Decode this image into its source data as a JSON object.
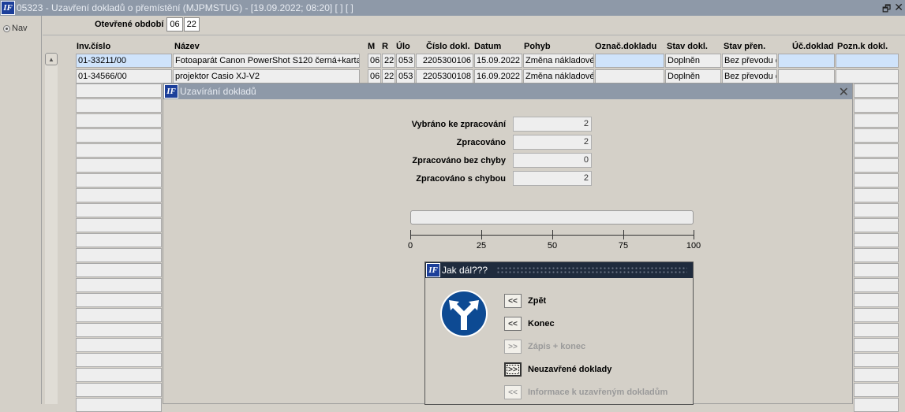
{
  "window": {
    "title": "05323 - Uzavření dokladů o přemístění (MJPMSTUG) - [19.09.2022; 08:20]  [ ]  [ ]",
    "logo": "IF",
    "restore_icon": "restore-icon",
    "close_icon": "close-icon"
  },
  "nav": {
    "label": "Nav"
  },
  "filter": {
    "label": "Otevřené období",
    "month": "06",
    "year": "22"
  },
  "table": {
    "columns": [
      "Inv.číslo",
      "Název",
      "M",
      "R",
      "Úlo",
      "Číslo dokl.",
      "Datum",
      "Pohyb",
      "Označ.dokladu",
      "Stav dokl.",
      "Stav přen.",
      "Úč.doklad",
      "Pozn.k dokl."
    ],
    "rows": [
      [
        "01-33211/00",
        "Fotoaparát Canon PowerShot S120 černá+karta",
        "06",
        "22",
        "053",
        "2205300106",
        "15.09.2022",
        "Změna nákladové",
        "",
        "Doplněn",
        "Bez převodu d",
        "",
        ""
      ],
      [
        "01-34566/00",
        "projektor Casio XJ-V2",
        "06",
        "22",
        "053",
        "2205300108",
        "16.09.2022",
        "Změna nákladové",
        "",
        "Doplněn",
        "Bez převodu d",
        "",
        ""
      ]
    ]
  },
  "closing_dialog": {
    "title": "Uzavírání dokladů",
    "stats": [
      {
        "label": "Vybráno ke zpracování",
        "value": "2"
      },
      {
        "label": "Zpracováno",
        "value": "2"
      },
      {
        "label": "Zpracováno bez chyby",
        "value": "0"
      },
      {
        "label": "Zpracováno s chybou",
        "value": "2"
      }
    ],
    "progress": 0,
    "scale": [
      "0",
      "25",
      "50",
      "75",
      "100"
    ]
  },
  "next_dialog": {
    "title": "Jak dál???",
    "sign_icon": "fork-road-sign-icon",
    "actions": [
      {
        "button": "<<",
        "label": "Zpět",
        "enabled": true
      },
      {
        "button": "<<",
        "label": "Konec",
        "enabled": true
      },
      {
        "button": ">>",
        "label": "Zápis + konec",
        "enabled": false
      },
      {
        "button": ">>",
        "label": "Neuzavřené doklady",
        "enabled": true
      },
      {
        "button": "<<",
        "label": "Informace k uzavřeným dokladům",
        "enabled": false
      }
    ]
  }
}
